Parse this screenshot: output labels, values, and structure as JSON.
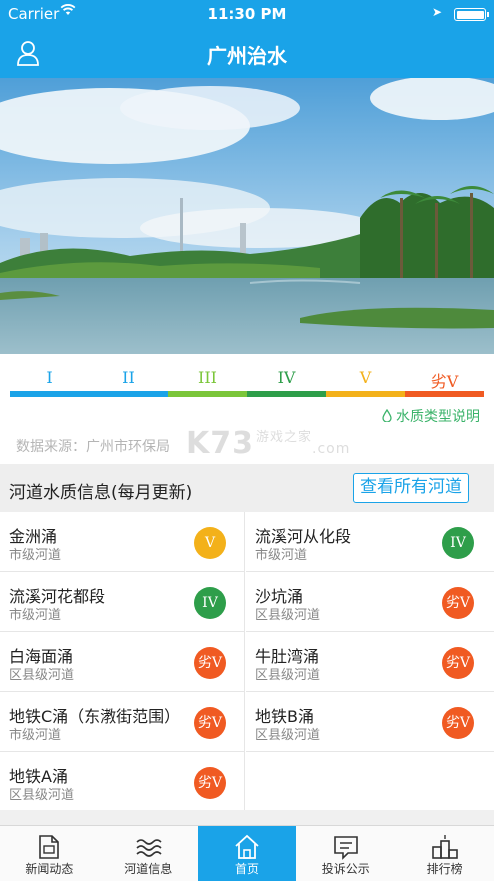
{
  "status_bar": {
    "carrier": "Carrier",
    "time": "11:30 PM"
  },
  "nav": {
    "title": "广州治水",
    "user_icon": "user-icon"
  },
  "levels": {
    "labels": [
      "I",
      "II",
      "III",
      "IV",
      "V",
      "劣V"
    ],
    "colors": [
      "#1aa3e8",
      "#1aa3e8",
      "#7bc63a",
      "#2e9e4a",
      "#f3b11a",
      "#f05a22"
    ]
  },
  "explain_link": "水质类型说明",
  "source": "数据来源：广州市环保局",
  "watermark": {
    "logo": "K73",
    "sub": "游戏之家",
    "domain": ".com"
  },
  "section": {
    "title": "河道水质信息(每月更新)",
    "all_button": "查看所有河道"
  },
  "rivers": [
    {
      "name": "金洲涌",
      "type": "市级河道",
      "level": "V",
      "color": "#f3b11a"
    },
    {
      "name": "流溪河从化段",
      "type": "市级河道",
      "level": "IV",
      "color": "#2e9e4a"
    },
    {
      "name": "流溪河花都段",
      "type": "市级河道",
      "level": "IV",
      "color": "#2e9e4a"
    },
    {
      "name": "沙坑涌",
      "type": "区县级河道",
      "level": "劣V",
      "color": "#f05a22"
    },
    {
      "name": "白海面涌",
      "type": "区县级河道",
      "level": "劣V",
      "color": "#f05a22"
    },
    {
      "name": "牛肚湾涌",
      "type": "区县级河道",
      "level": "劣V",
      "color": "#f05a22"
    },
    {
      "name": "地铁C涌（东漖街范围）",
      "type": "市级河道",
      "level": "劣V",
      "color": "#f05a22"
    },
    {
      "name": "地铁B涌",
      "type": "区县级河道",
      "level": "劣V",
      "color": "#f05a22"
    },
    {
      "name": "地铁A涌",
      "type": "区县级河道",
      "level": "劣V",
      "color": "#f05a22"
    }
  ],
  "tabs": [
    {
      "label": "新闻动态",
      "icon": "news-icon"
    },
    {
      "label": "河道信息",
      "icon": "waves-icon"
    },
    {
      "label": "首页",
      "icon": "home-icon",
      "active": true
    },
    {
      "label": "投诉公示",
      "icon": "complaint-icon"
    },
    {
      "label": "排行榜",
      "icon": "ranking-icon"
    }
  ]
}
